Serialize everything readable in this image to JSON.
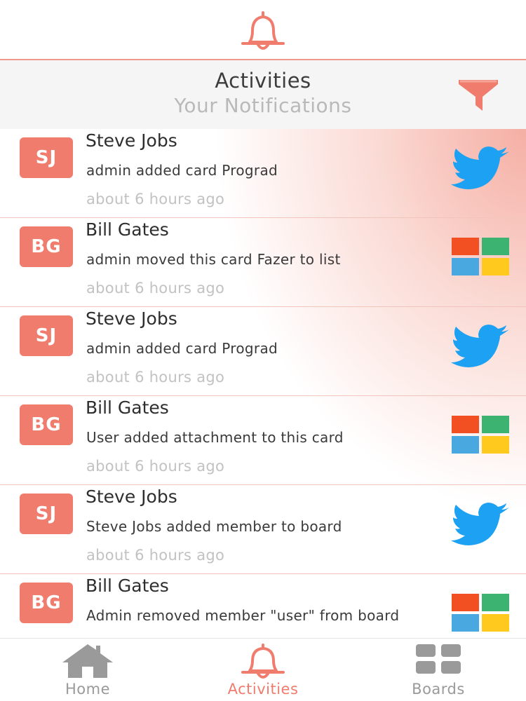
{
  "header": {
    "title": "Activities",
    "subtitle": "Your Notifications",
    "filter_icon": "filter-icon",
    "bell_icon": "bell-icon"
  },
  "colors": {
    "accent": "#f07c6e",
    "twitter": "#1da1f2",
    "windows_red": "#f25022",
    "windows_green": "#3cb371",
    "windows_blue": "#4aa8e0",
    "windows_yellow": "#ffc91d",
    "tab_inactive": "#9a9a9a"
  },
  "notifications": [
    {
      "initials": "SJ",
      "name": "Steve Jobs",
      "action": "admin added card Prograd",
      "time": "about 6 hours ago",
      "brand": "twitter-icon"
    },
    {
      "initials": "BG",
      "name": "Bill Gates",
      "action": "admin moved this card Fazer to list",
      "time": "about 6 hours ago",
      "brand": "windows-icon"
    },
    {
      "initials": "SJ",
      "name": "Steve Jobs",
      "action": "admin added card Prograd",
      "time": "about 6 hours ago",
      "brand": "twitter-icon"
    },
    {
      "initials": "BG",
      "name": "Bill Gates",
      "action": "User added attachment to this card",
      "time": "about 6 hours ago",
      "brand": "windows-icon"
    },
    {
      "initials": "SJ",
      "name": "Steve Jobs",
      "action": "Steve Jobs added member to board",
      "time": "about 6 hours ago",
      "brand": "twitter-icon"
    },
    {
      "initials": "BG",
      "name": "Bill Gates",
      "action": "Admin removed member \"user\" from board",
      "time": "",
      "brand": "windows-icon"
    }
  ],
  "tabs": [
    {
      "label": "Home",
      "icon": "home-icon",
      "active": false
    },
    {
      "label": "Activities",
      "icon": "bell-icon",
      "active": true
    },
    {
      "label": "Boards",
      "icon": "grid-icon",
      "active": false
    }
  ]
}
